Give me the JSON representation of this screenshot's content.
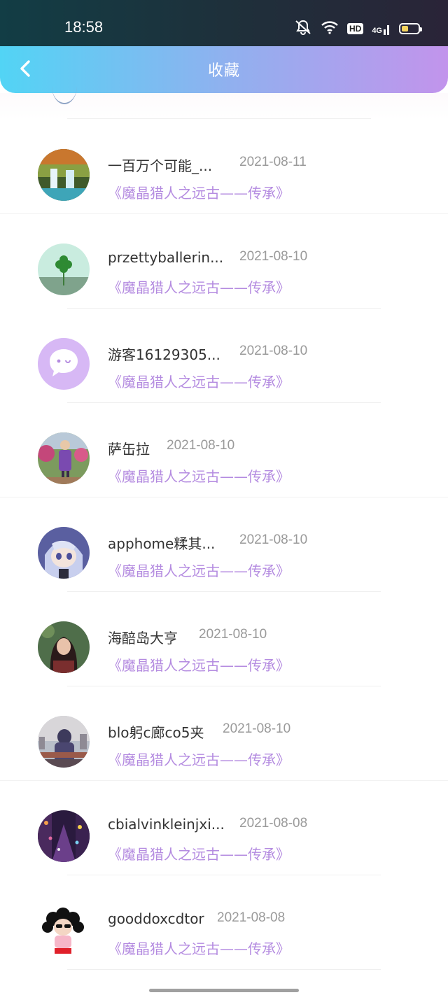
{
  "status_bar": {
    "time": "18:58",
    "hd_label": "HD",
    "network_label": "4G"
  },
  "header": {
    "title": "收藏"
  },
  "items": [
    {
      "name": "一百万个可能_...",
      "date": "2021-08-11",
      "book": "《魔晶猎人之远古——传承》",
      "avatar": "waterfall-photo"
    },
    {
      "name": "przettyballerin...",
      "date": "2021-08-10",
      "book": "《魔晶猎人之远古——传承》",
      "avatar": "clover-photo"
    },
    {
      "name": "游客16129305...",
      "date": "2021-08-10",
      "book": "《魔晶猎人之远古——传承》",
      "avatar": "default-chat-avatar"
    },
    {
      "name": "萨缶拉",
      "date": "2021-08-10",
      "book": "《魔晶猎人之远古——传承》",
      "avatar": "street-photo"
    },
    {
      "name": "apphome糅其...",
      "date": "2021-08-10",
      "book": "《魔晶猎人之远古——传承》",
      "avatar": "anime-character"
    },
    {
      "name": "海醅岛大亨",
      "date": "2021-08-10",
      "book": "《魔晶猎人之远古——传承》",
      "avatar": "woman-portrait"
    },
    {
      "name": "blo躬c廊co5夹",
      "date": "2021-08-10",
      "book": "《魔晶猎人之远古——传承》",
      "avatar": "city-silhouette"
    },
    {
      "name": "cbialvinkleinjxi...",
      "date": "2021-08-08",
      "book": "《魔晶猎人之远古——传承》",
      "avatar": "night-street"
    },
    {
      "name": "gooddoxcdtor",
      "date": "2021-08-08",
      "book": "《魔晶猎人之远古——传承》",
      "avatar": "cartoon-character"
    }
  ],
  "colors": {
    "accent_purple": "#b48be0",
    "header_start": "#52d4f5",
    "header_end": "#c294ec"
  }
}
